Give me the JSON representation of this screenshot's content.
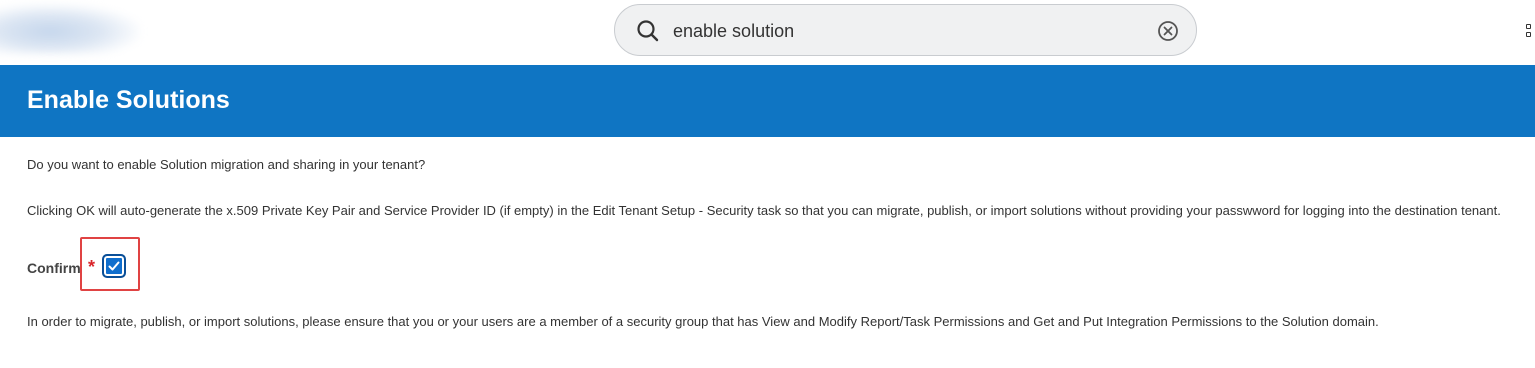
{
  "search": {
    "value": "enable solution",
    "icon": "search-icon",
    "clear_icon": "clear-icon"
  },
  "header": {
    "apps_icon": "apps-grid-icon"
  },
  "page": {
    "title": "Enable Solutions",
    "question": "Do you want to enable Solution migration and sharing in your tenant?",
    "description": "Clicking OK will auto-generate the x.509 Private Key Pair and Service Provider ID (if empty) in the Edit Tenant Setup - Security task so that you can migrate, publish, or import solutions without providing your passwword for logging into the destination tenant.",
    "confirm_label": "Confirm",
    "required_mark": "*",
    "confirm_checked": true,
    "note": "In order to migrate, publish, or import solutions, please ensure that you or your users are a member of a security group that has View and Modify Report/Task Permissions and Get and Put Integration Permissions to the Solution domain."
  },
  "colors": {
    "banner": "#0f75c3",
    "checkbox": "#0f6ecd",
    "required": "#d9252a",
    "highlight": "#e04343"
  }
}
